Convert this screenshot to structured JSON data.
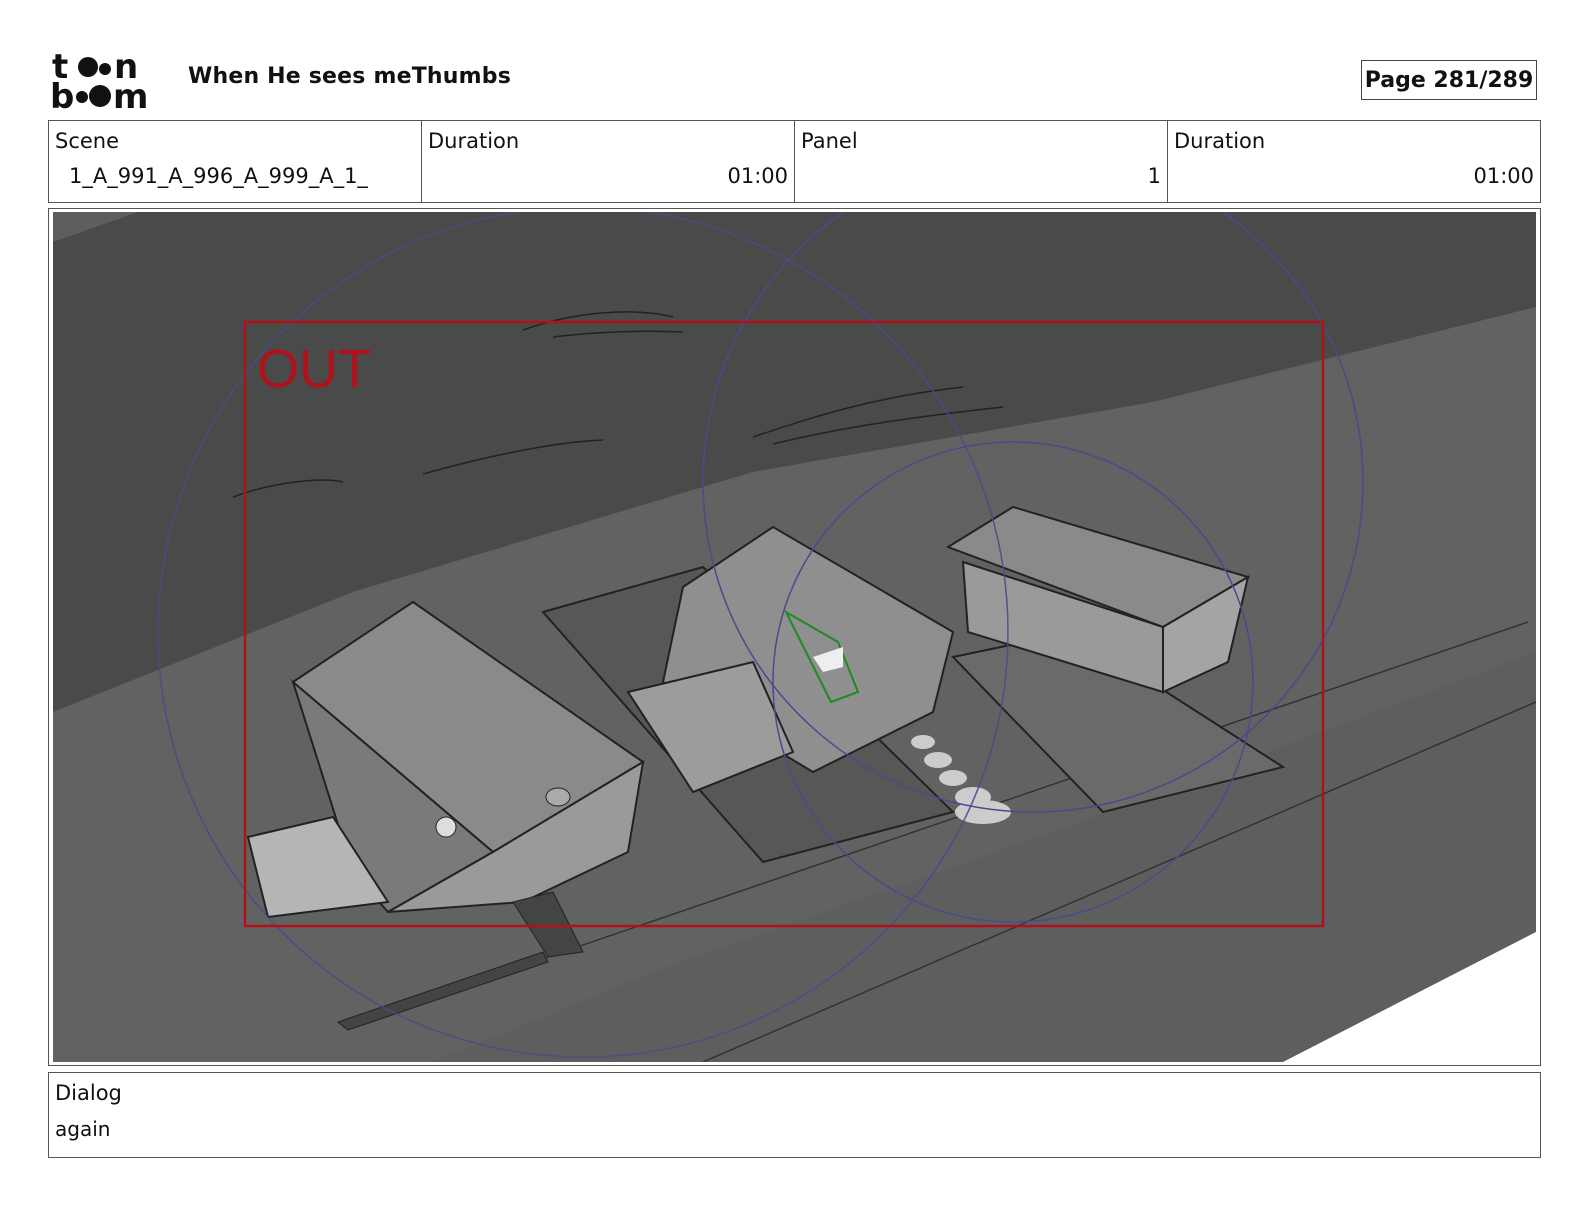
{
  "header": {
    "project_title": "When He sees meThumbs",
    "page_label": "Page 281/289",
    "logo_text": "toon boom"
  },
  "info": {
    "scene_label": "Scene",
    "scene_value": "1_A_991_A_996_A_999_A_1_",
    "scene_duration_label": "Duration",
    "scene_duration_value": "01:00",
    "panel_label": "Panel",
    "panel_value": "1",
    "panel_duration_label": "Duration",
    "panel_duration_value": "01:00"
  },
  "panel": {
    "frame_label": "OUT",
    "frame_color": "#b0121b",
    "camera_path_color": "#4a4a8c",
    "highlight_color": "#1f8a1f"
  },
  "dialog": {
    "label": "Dialog",
    "text": "again"
  }
}
